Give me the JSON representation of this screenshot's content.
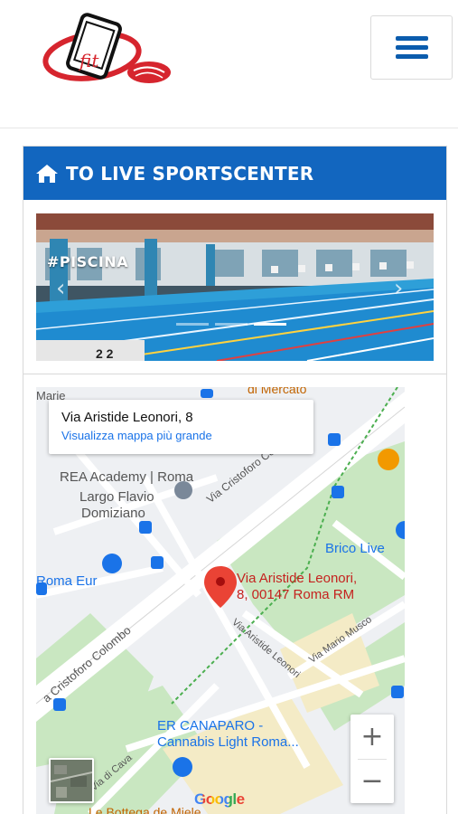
{
  "header": {
    "logo_text": "fit",
    "menu_icon": "hamburger-icon"
  },
  "card": {
    "home_icon": "home-icon",
    "title": "TO LIVE SPORTSCENTER",
    "slide_label": "#PISCINA",
    "prev_arrow": "‹",
    "next_arrow": "›",
    "slide_count": 3,
    "active_slide": 3
  },
  "map": {
    "info_address": "Via Aristide Leonori, 8",
    "info_link": "Visualizza mappa più grande",
    "labels": {
      "mercato": "di Mercato",
      "marie": "Marie",
      "rea": "REA Academy | Roma",
      "largo1": "Largo Flavio",
      "largo2": "Domiziano",
      "cristoforo_top": "Via Cristoforo Co",
      "brico": "Brico Live",
      "roma_eur": "Roma Eur",
      "pin_line1": "Via Aristide Leonori,",
      "pin_line2": "8, 00147 Roma RM",
      "cristoforo_bottom": "a Cristoforo Colombo",
      "leonori_street": "Via Aristide Leonori",
      "musco": "Via Mario Musco",
      "canaparo1": "ER CANAPARO -",
      "canaparo2": "Cannabis Light Roma...",
      "cava": "Via di Cava",
      "bottega": "Le Bottega de Miele",
      "google": "Google"
    },
    "zoom_in": "+",
    "zoom_out": "−",
    "colors": {
      "pin": "#ea4335",
      "poi_blue": "#1a73e8",
      "park": "#c9e7c1"
    }
  }
}
